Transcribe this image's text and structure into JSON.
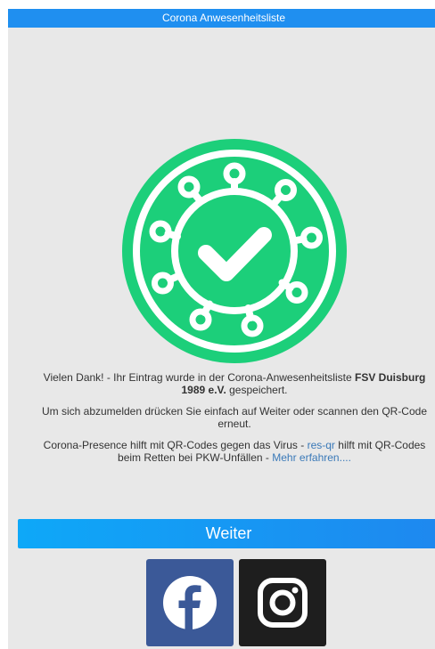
{
  "header": {
    "title": "Corona Anwesenheitsliste"
  },
  "colors": {
    "accent": "#1f8ff0",
    "hero_green": "#1ccf7a",
    "facebook": "#3b5998",
    "instagram": "#1e1e1e"
  },
  "hero": {
    "icon": "virus-checkmark-icon"
  },
  "message": {
    "thanks_prefix": "Vielen Dank! - Ihr Eintrag wurde in der Corona-Anwesenheitsliste",
    "club_name": "FSV Duisburg 1989 e.V.",
    "thanks_suffix": "gespeichert.",
    "logout_hint": "Um sich abzumelden drücken Sie einfach auf Weiter oder scannen den QR-Code erneut.",
    "promo_prefix": "Corona-Presence hilft mit QR-Codes gegen das Virus -",
    "promo_link": "res-qr",
    "promo_middle": "hilft mit QR-Codes beim Retten bei PKW-Unfällen -",
    "more_link": "Mehr erfahren...."
  },
  "actions": {
    "continue_label": "Weiter"
  },
  "social": [
    {
      "name": "Facebook",
      "icon": "facebook-icon"
    },
    {
      "name": "Instagram",
      "icon": "instagram-icon"
    }
  ]
}
